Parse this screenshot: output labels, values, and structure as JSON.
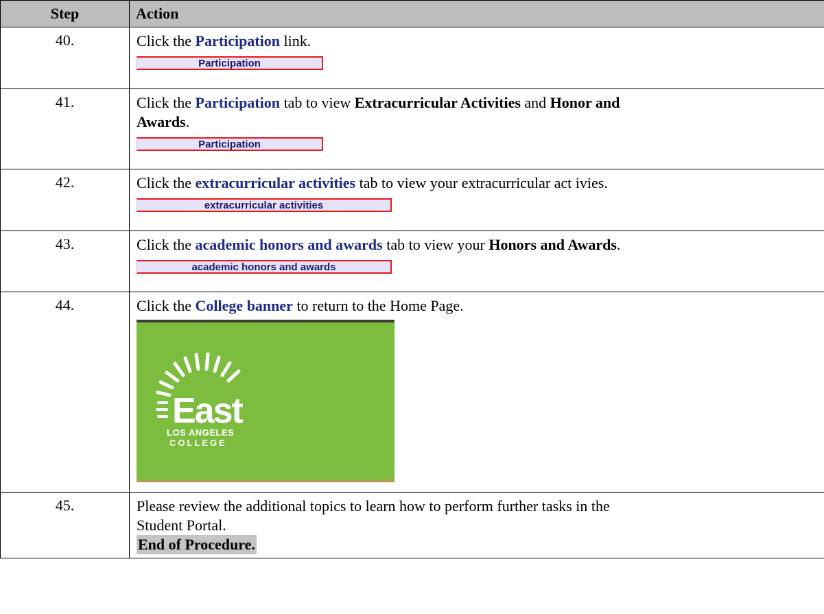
{
  "header": {
    "step": "Step",
    "action": "Action"
  },
  "rows": [
    {
      "num": "40.",
      "pre": "Click the ",
      "link": "Participation",
      "post": " link.",
      "button": "Participation"
    },
    {
      "num": "41.",
      "pre": "Click the ",
      "link": "Participation",
      "mid": " tab to view ",
      "bold1": "Extracurricular Activities",
      "and": " and ",
      "bold2": "Honor and",
      "bold2b": "Awards",
      "post": ".",
      "button": "Participation"
    },
    {
      "num": "42.",
      "pre": "Click the ",
      "link": "extracurricular activities",
      "post": " tab to view your extracurricular act ivies.",
      "button": "extracurricular activities"
    },
    {
      "num": "43.",
      "pre": "Click the ",
      "link": "academic honors and awards",
      "mid": " tab to view your ",
      "bold1": "Honors and Awards",
      "post": ".",
      "button": "academic honors and awards"
    },
    {
      "num": "44.",
      "pre": "Click the ",
      "link": "College banner",
      "post": " to return to the Home Page.",
      "banner": {
        "word": "East",
        "line1": "LOS ANGELES",
        "line2": "COLLEGE"
      }
    },
    {
      "num": "45.",
      "line1": "Please review the additional topics to learn how to perform further tasks in the",
      "line2": "Student Portal.",
      "end": "End of Procedure."
    }
  ],
  "colors": {
    "header_bg": "#bdbdbd",
    "link": "#1c2a8a",
    "button_bg": "#e8e2f8",
    "button_border": "#e8181b",
    "banner_green": "#7cbd3f"
  }
}
